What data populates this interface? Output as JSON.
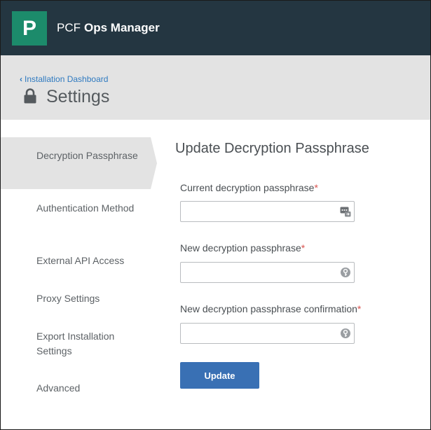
{
  "app": {
    "logo_letter": "P",
    "title_prefix": "PCF",
    "title_strong": "Ops Manager"
  },
  "header": {
    "back_link": "Installation Dashboard",
    "title": "Settings"
  },
  "sidebar": {
    "items": [
      {
        "label": "Decryption Passphrase",
        "active": true
      },
      {
        "label": "Authentication Method",
        "active": false
      },
      {
        "label": "External API Access",
        "active": false
      },
      {
        "label": "Proxy Settings",
        "active": false
      },
      {
        "label": "Export Installation Settings",
        "active": false
      },
      {
        "label": "Advanced",
        "active": false
      }
    ]
  },
  "form": {
    "title": "Update Decryption Passphrase",
    "required_marker": "*",
    "fields": [
      {
        "label": "Current decryption passphrase",
        "value": "",
        "icon": "password-manager-icon"
      },
      {
        "label": "New decryption passphrase",
        "value": "",
        "icon": "key-icon"
      },
      {
        "label": "New decryption passphrase confirmation",
        "value": "",
        "icon": "key-icon"
      }
    ],
    "submit_label": "Update"
  },
  "colors": {
    "topbar": "#243641",
    "logo": "#1c8b6b",
    "header_band": "#e3e3e3",
    "link": "#2f7ac0",
    "required": "#d9534f",
    "button": "#3970b4"
  }
}
